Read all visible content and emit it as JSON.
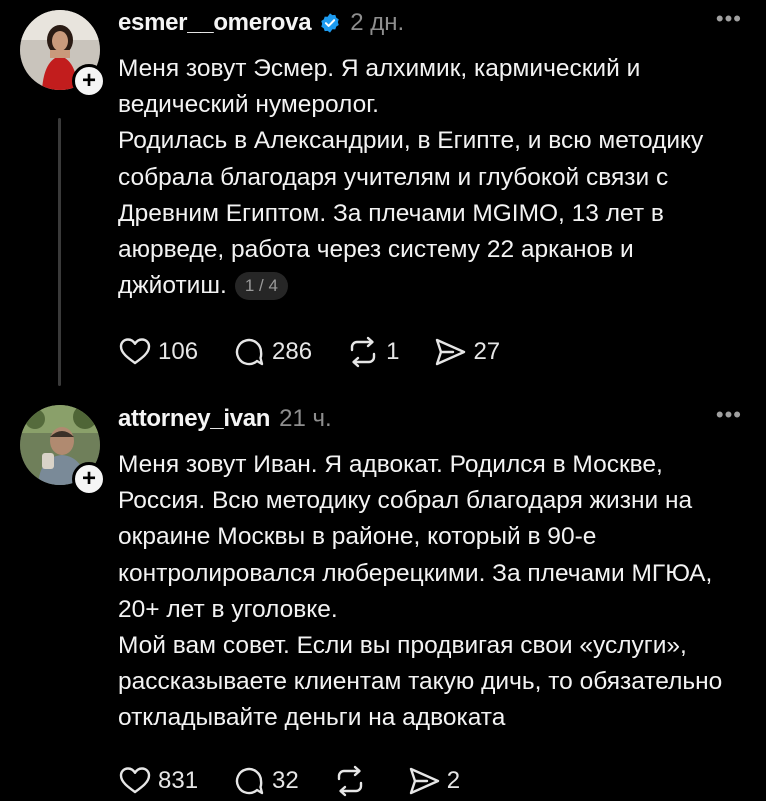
{
  "posts": [
    {
      "username": "esmer__omerova",
      "verified": true,
      "time": "2 дн.",
      "more_icon": "•••",
      "follow_icon": "+",
      "text": "Меня зовут Эсмер. Я алхимик, кармический и\nведический нумеролог.\nРодилась в Александрии, в Египте, и всю методику\nсобрала благодаря учителям и глубокой связи с\nДревним Египтом. За плечами MGIMO, 13 лет в\nаюрведе, работа через систему 22 арканов и\nджйотиш.",
      "page_counter": "1 / 4",
      "actions": {
        "likes": "106",
        "comments": "286",
        "reposts": "1",
        "shares": "27"
      }
    },
    {
      "username": "attorney_ivan",
      "verified": false,
      "time": "21 ч.",
      "more_icon": "•••",
      "follow_icon": "+",
      "text": "Меня зовут Иван. Я адвокат. Родился в Москве,\nРоссия. Всю методику собрал благодаря жизни на\nокраине Москвы в районе, который в 90-е\nконтролировался люберецкими. За плечами МГЮА,\n20+ лет в уголовке.\nМой вам совет. Если вы продвигая свои «услуги»,\nрассказываете клиентам такую дичь, то обязательно\nоткладывайте деньги на адвоката",
      "actions": {
        "likes": "831",
        "comments": "32",
        "reposts": "",
        "shares": "2"
      }
    }
  ],
  "colors": {
    "background": "#000000",
    "text": "#f3f3f3",
    "muted": "#8e8e8e",
    "verified_badge": "#1d9bf0"
  }
}
